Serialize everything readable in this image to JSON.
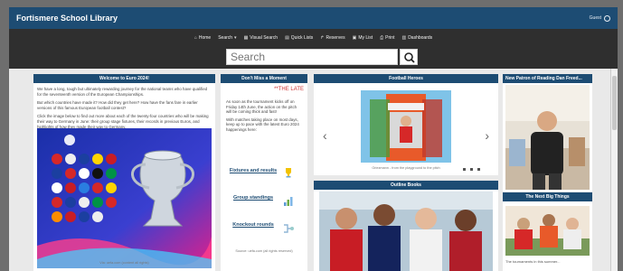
{
  "header": {
    "title": "Fortismere School Library",
    "guest_label": "Guest"
  },
  "nav": {
    "items": [
      {
        "label": "Home",
        "icon": "home-icon"
      },
      {
        "label": "Search",
        "icon": "caret-down-icon"
      },
      {
        "label": "Visual Search",
        "icon": "visual-search-icon"
      },
      {
        "label": "Quick Lists",
        "icon": "list-icon"
      },
      {
        "label": "Reserves",
        "icon": "reserves-icon"
      },
      {
        "label": "My List",
        "icon": "my-list-icon"
      },
      {
        "label": "Print",
        "icon": "print-icon"
      },
      {
        "label": "Dashboards",
        "icon": "dashboard-icon"
      }
    ]
  },
  "search": {
    "placeholder": "Search"
  },
  "panels": {
    "euro": {
      "title": "Welcome to Euro 2024!",
      "p1": "We have a long, tough but ultimately rewarding journey for the national teams who have qualified for the seventeenth version of the European Championships.",
      "p2": "But which countries have made it? How did they get here? How have the fans fare in earlier versions of this famous European football contest?",
      "p3": "Click the image below to find out more about each of the twenty-four countries who will be making their way to Germany in June: their group stage fixtures, their records in previous Euros, and highlights of how they made their way to Germany.",
      "caption": "Via: uefa.com (content all rights)"
    },
    "moment": {
      "title": "Don't Miss a Moment",
      "late_label": "**THE LATE",
      "p1": "As soon as the tournament kicks off on Friday 14th June, the action on the pitch will be coming thick and fast!",
      "p2": "With matches taking place on most days, keep up to pace with the latest Euro 2024 happenings here:",
      "link1": "Fixtures and results",
      "link2": "Group standings",
      "link3": "Knockout rounds",
      "caption": "Source: uefa.com (all rights reserved)"
    },
    "heroes": {
      "title": "Football Heroes",
      "caption": "Griezmann - from the playground to the pitch"
    },
    "outline": {
      "title": "Outline Books"
    },
    "patron": {
      "title": "New Patron of Reading Dan Freed..."
    },
    "next": {
      "title": "The Next Big Things",
      "caption": "The tournaments in this summer..."
    }
  },
  "colors": {
    "header_blue": "#1d4c73",
    "nav_dark": "#2f2f2f",
    "accent_red": "#c33"
  }
}
